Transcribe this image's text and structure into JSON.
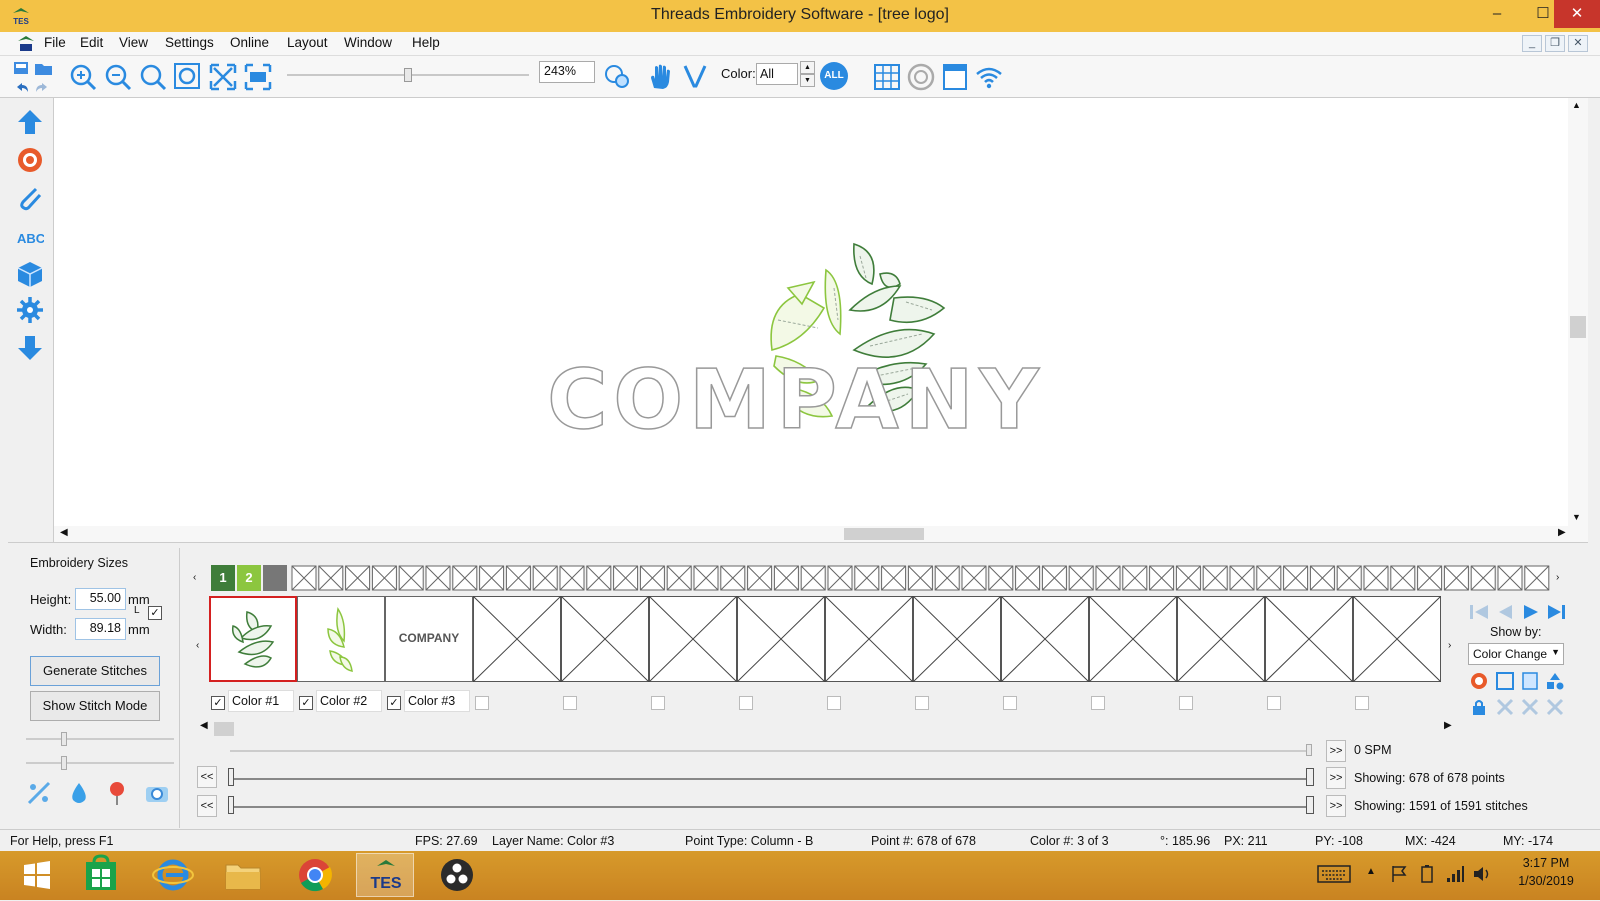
{
  "window": {
    "title": "Threads Embroidery Software - [tree logo]",
    "app_badge": "TES",
    "minimize": "–",
    "maximize": "☐",
    "close": "✕"
  },
  "menu": [
    "File",
    "Edit",
    "View",
    "Settings",
    "Online",
    "Layout",
    "Window",
    "Help"
  ],
  "mdi_controls": {
    "minimize": "_",
    "restore": "❐",
    "close": "✕"
  },
  "toolbar": {
    "zoom_value": "243%",
    "color_label": "Color:",
    "color_value": "All",
    "all_badge": "ALL",
    "zoom_slider_fraction": 0.5
  },
  "canvas": {
    "company_text": "COMPANY"
  },
  "sizes": {
    "title": "Embroidery Sizes",
    "height_label": "Height:",
    "height_value": "55.00",
    "height_unit": "mm",
    "width_label": "Width:",
    "width_value": "89.18",
    "width_unit": "mm",
    "lock_letter": "L",
    "generate_button": "Generate Stitches",
    "stitch_mode_button": "Show Stitch Mode"
  },
  "swatches": {
    "s1": "1",
    "s2": "2"
  },
  "colors": [
    {
      "label": "Color #1",
      "checked": true
    },
    {
      "label": "Color #2",
      "checked": true
    },
    {
      "label": "Color #3",
      "checked": true
    }
  ],
  "color_cell_company": "COMPANY",
  "right_panel": {
    "show_by_label": "Show by:",
    "show_by_value": "Color Change"
  },
  "stitch_info": {
    "spm": "0 SPM",
    "points": "Showing: 678 of 678 points",
    "stitches": "Showing: 1591 of 1591 stitches"
  },
  "status": {
    "help": "For Help, press F1",
    "fps": "FPS: 27.69",
    "layer": "Layer Name: Color #3",
    "point_type": "Point Type: Column - B",
    "point_num": "Point #: 678 of 678",
    "color_num": "Color #: 3 of 3",
    "angle": "°: 185.96",
    "px": "PX: 211",
    "py": "PY: -108",
    "mx": "MX: -424",
    "my": "MY: -174"
  },
  "taskbar": {
    "tes_label": "TES",
    "time": "3:17 PM",
    "date": "1/30/2019"
  },
  "colors_theme": {
    "title_bar": "#f3c246",
    "dark_green": "#3f7d3a",
    "light_green": "#8cc63f",
    "gray": "#777777"
  }
}
